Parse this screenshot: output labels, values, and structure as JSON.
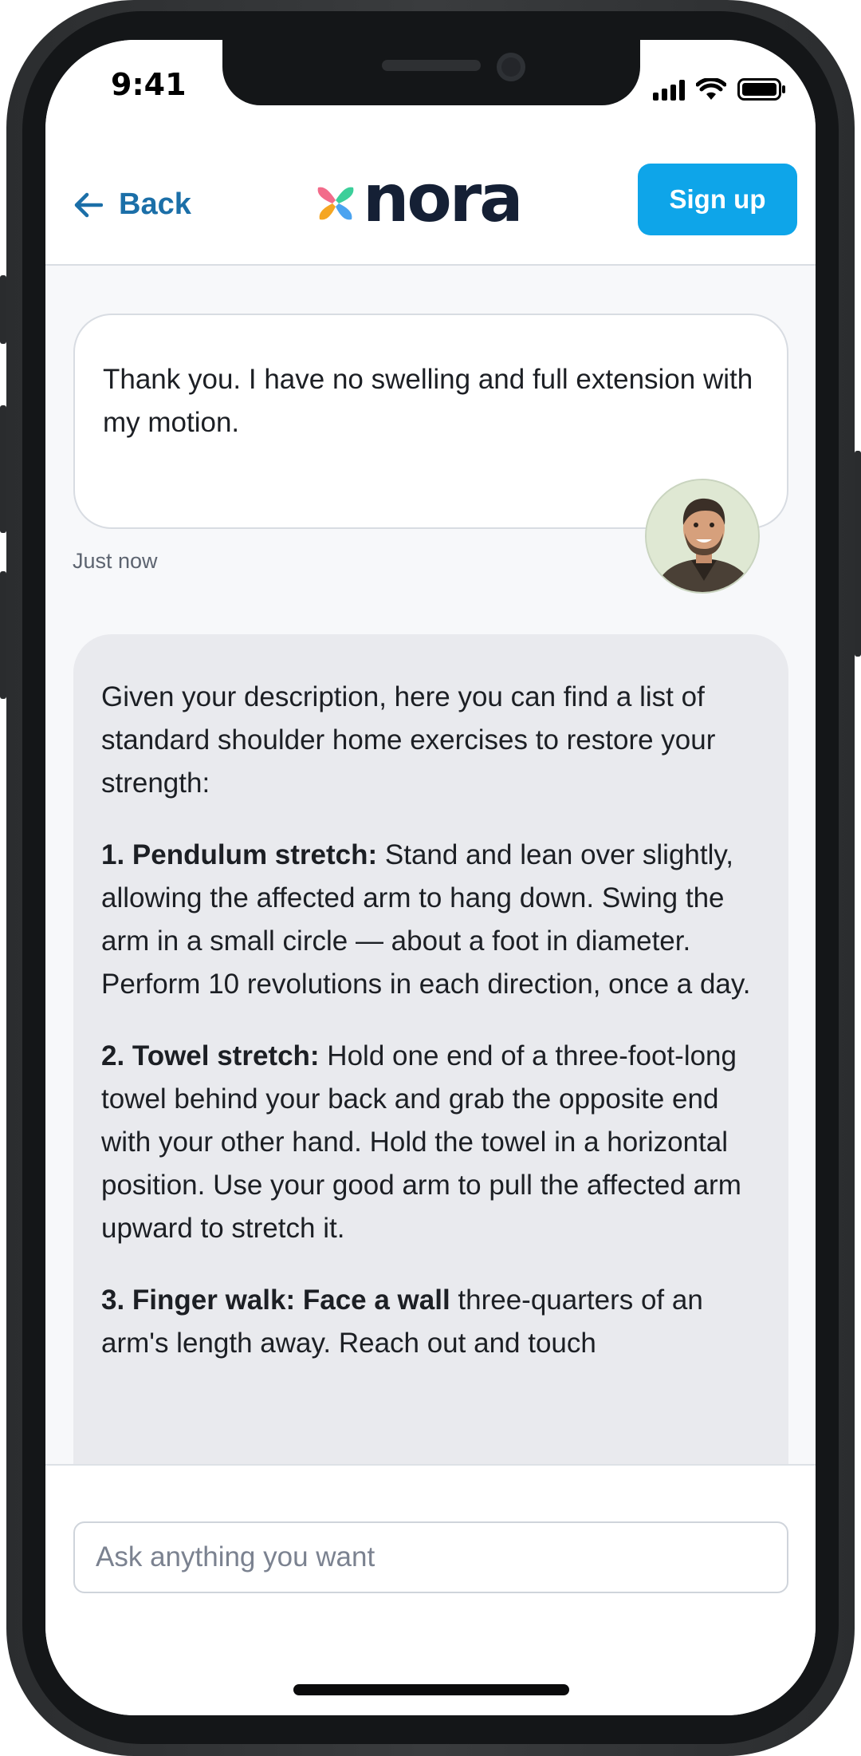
{
  "status_bar": {
    "time": "9:41"
  },
  "header": {
    "back_label": "Back",
    "logo_text": "nora",
    "signup_label": "Sign up"
  },
  "conversation": {
    "user_message": "Thank you. I have no swelling and full extension with my motion.",
    "user_timestamp": "Just now",
    "bot_intro": "Given your description, here you can find a list of standard shoulder home exercises to restore your strength:",
    "items": [
      {
        "title": "1. Pendulum stretch:",
        "text": " Stand and lean over slightly, allowing the affected arm to hang down. Swing the arm in a small circle — about a foot in diameter. Perform 10 revolutions in each direction, once a day."
      },
      {
        "title": "2. Towel stretch:",
        "text": " Hold one end of a three-foot-long towel behind your back and grab the opposite end with your other hand. Hold the towel in a horizontal position. Use your good arm to pull the affected arm upward to stretch it."
      },
      {
        "title": "3. Finger walk: Face a wall",
        "text": " three-quarters of an arm's length away. Reach out and touch"
      }
    ]
  },
  "composer": {
    "placeholder": "Ask anything you want"
  },
  "colors": {
    "accent": "#0ea5e9",
    "back_link": "#1b6fa8",
    "logo_text": "#152035",
    "bot_bubble": "#e9eaee"
  },
  "icons": [
    "back-arrow-icon",
    "nora-logo-icon",
    "signal-icon",
    "wifi-icon",
    "battery-icon"
  ]
}
